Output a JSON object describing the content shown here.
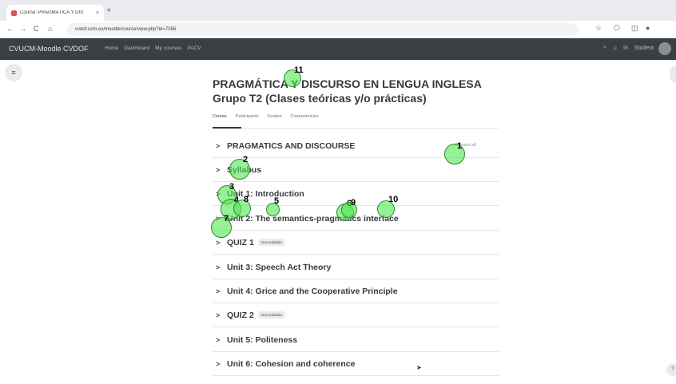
{
  "browser": {
    "tab_title": "Course: PRAGMÁTICA Y DIS",
    "tab_close": "×",
    "new_tab": "+",
    "url": "cvdof.ucm.es/moodle/course/view.php?id=7056",
    "back": "←",
    "forward": "→",
    "reload": "C",
    "home": "⌂"
  },
  "moodle": {
    "brand": "CVUCM-Moodle CVDOF",
    "menu": [
      "Home",
      "Dashboard",
      "My courses",
      "PACV"
    ],
    "user": "Student"
  },
  "course": {
    "title": "PRAGMÁTICA Y DISCURSO EN LENGUA INGLESA Grupo T2 (Clases teóricas y/o prácticas)",
    "tabs": [
      "Course",
      "Participants",
      "Grades",
      "Competencies"
    ],
    "expand_all": "Expand all",
    "sections": [
      {
        "label": "PRAGMATICS AND DISCOURSE",
        "badge": ""
      },
      {
        "label": "Syllabus",
        "badge": ""
      },
      {
        "label": "Unit 1: Introduction",
        "badge": ""
      },
      {
        "label": "Unit 2: The semantics-pragmatics interface",
        "badge": ""
      },
      {
        "label": "QUIZ 1",
        "badge": "Not available"
      },
      {
        "label": "Unit 3: Speech Act Theory",
        "badge": ""
      },
      {
        "label": "Unit 4: Grice and the Cooperative Principle",
        "badge": ""
      },
      {
        "label": "QUIZ 2",
        "badge": "Not available"
      },
      {
        "label": "Unit 5: Politeness",
        "badge": ""
      },
      {
        "label": "Unit 6: Cohesion and coherence",
        "badge": ""
      }
    ]
  },
  "markers": [
    "1",
    "2",
    "3",
    "4",
    "5",
    "6",
    "7",
    "8",
    "9",
    "10",
    "11"
  ],
  "misc": {
    "help": "?",
    "drawer_icon": "≡"
  }
}
